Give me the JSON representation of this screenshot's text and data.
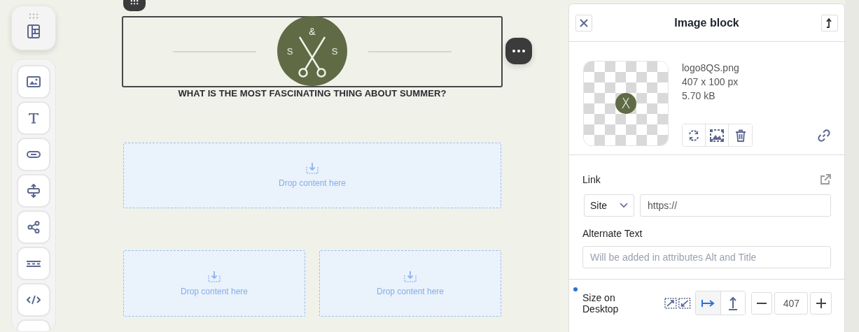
{
  "toolbar": {
    "groups": [
      {
        "items": [
          {
            "kind": "layout"
          }
        ]
      },
      {
        "items": [
          {
            "kind": "image"
          },
          {
            "kind": "text"
          },
          {
            "kind": "button"
          },
          {
            "kind": "spacer"
          },
          {
            "kind": "social"
          },
          {
            "kind": "divider"
          },
          {
            "kind": "html"
          },
          {
            "kind": "blank"
          }
        ]
      }
    ]
  },
  "canvas": {
    "logo": {
      "ampersand": "&",
      "left_letter": "S",
      "right_letter": "S"
    },
    "heading": "WHAT IS THE MOST FASCINATING THING ABOUT SUMMER?",
    "drop_rows": [
      [
        {
          "text": "Drop content here"
        }
      ],
      [
        {
          "text": "Drop content here"
        },
        {
          "text": "Drop content here"
        }
      ]
    ]
  },
  "panel": {
    "title": "Image block",
    "file": {
      "name": "logo8QS.png",
      "dimensions": "407 x 100 px",
      "size": "5.70 kB"
    },
    "link": {
      "label": "Link",
      "type": "Site",
      "url": "https://"
    },
    "alt_text": {
      "label": "Alternate Text",
      "placeholder": "Will be added in attributes Alt and Title"
    },
    "size": {
      "label": "Size on Desktop",
      "modified": true,
      "value": "407",
      "modes": [
        {
          "kind": "width",
          "selected": true
        },
        {
          "kind": "height",
          "selected": false
        }
      ]
    }
  }
}
